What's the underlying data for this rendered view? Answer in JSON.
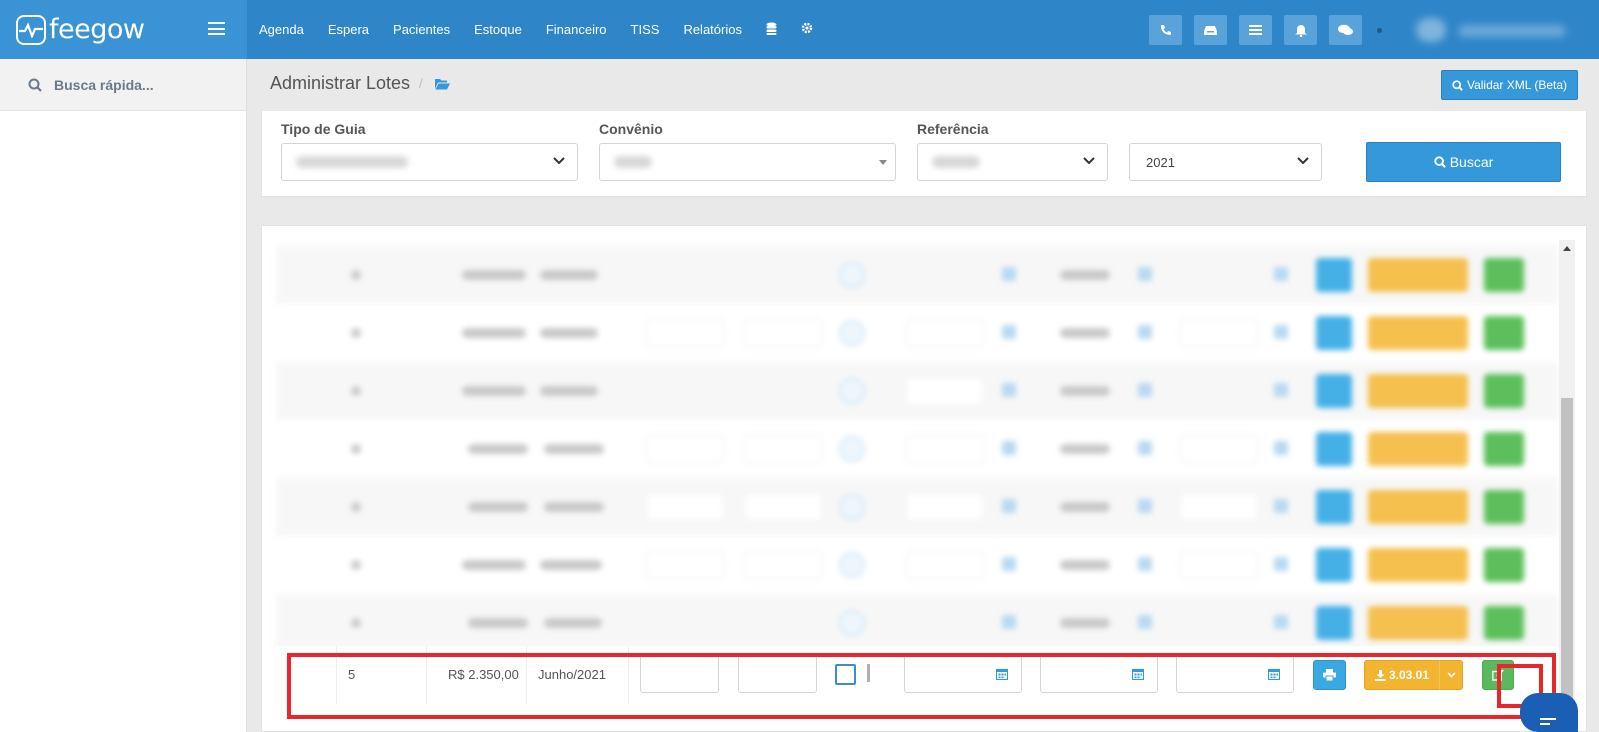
{
  "app": {
    "brand_name": "feegow",
    "colors": {
      "topbar": "#2e86c9",
      "primary": "#3498db",
      "warning": "#f2b431",
      "success": "#5cb85c",
      "highlight": "#e8262b"
    }
  },
  "topnav": {
    "items": [
      "Agenda",
      "Espera",
      "Pacientes",
      "Estoque",
      "Financeiro",
      "TISS",
      "Relatórios"
    ],
    "icons": [
      "database-icon",
      "gear-icon"
    ],
    "actions": [
      "phone-icon",
      "inbox-icon",
      "list-icon",
      "bell-icon",
      "chat-icon"
    ]
  },
  "sidebar": {
    "search_label": "Busca rápida..."
  },
  "header": {
    "title": "Administrar Lotes",
    "breadcrumb_sep": "/",
    "validate_button": "Validar XML (Beta)"
  },
  "filters": {
    "tipo_guia": {
      "label": "Tipo de Guia"
    },
    "convenio": {
      "label": "Convênio"
    },
    "referencia": {
      "label": "Referência"
    },
    "ano": {
      "value": "2021"
    },
    "search_button": "Buscar"
  },
  "table": {
    "highlighted_row": {
      "number": "5",
      "value": "R$ 2.350,00",
      "reference": "Junho/2021",
      "xml_version": "3.03.01"
    }
  }
}
